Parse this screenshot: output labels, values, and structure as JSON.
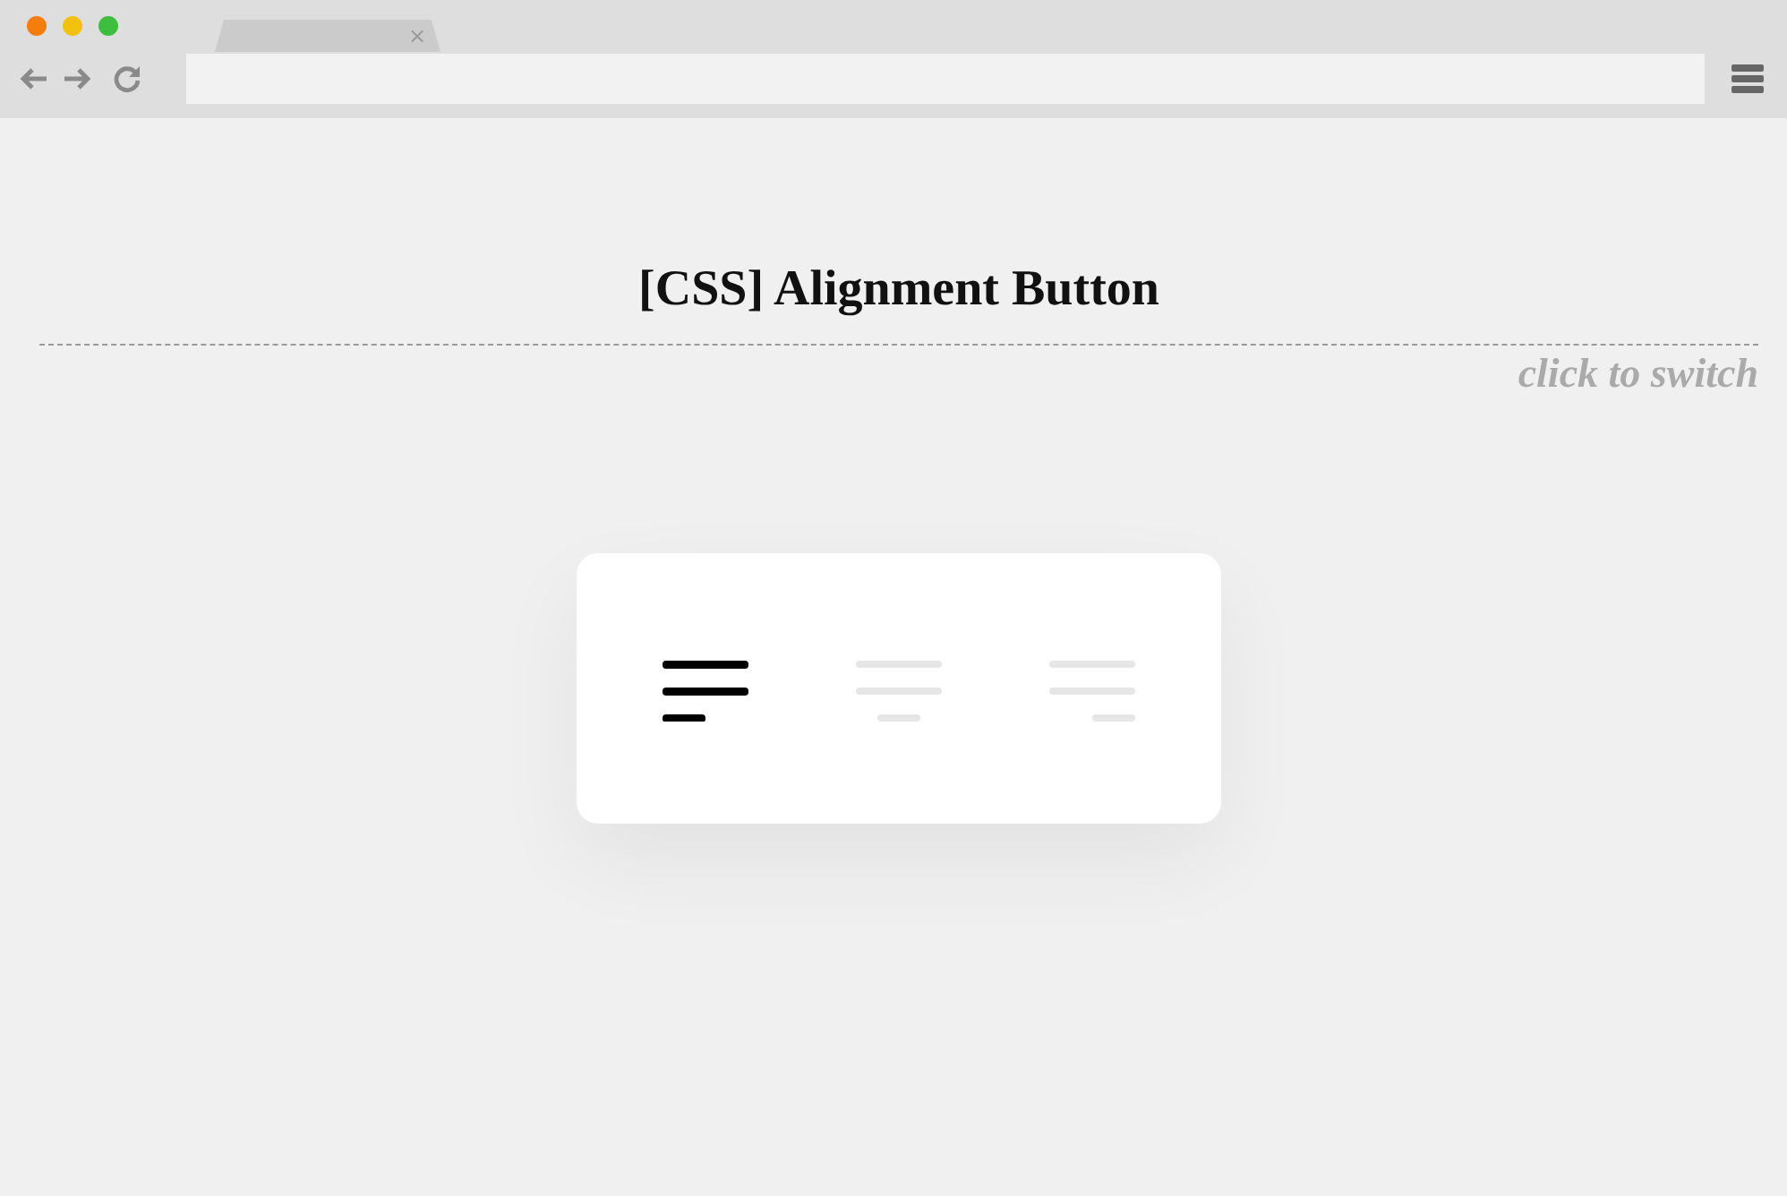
{
  "browser": {
    "tab": {
      "close": "×"
    }
  },
  "page": {
    "title": "[CSS] Alignment Button",
    "hint": "click to switch"
  },
  "alignment_options": [
    {
      "kind": "left",
      "selected": true
    },
    {
      "kind": "center",
      "selected": false
    },
    {
      "kind": "right",
      "selected": false
    }
  ]
}
